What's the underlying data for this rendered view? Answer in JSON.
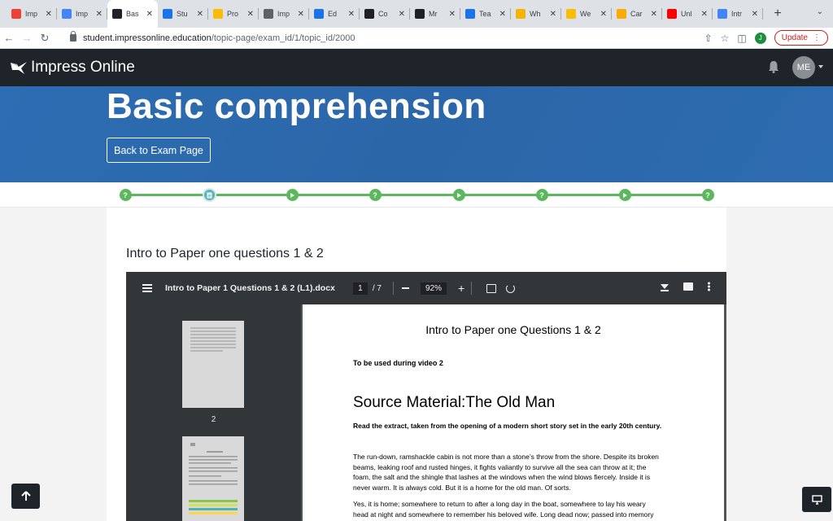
{
  "browser": {
    "tabs": [
      {
        "title": "Imp",
        "favicon": "gmail-icon",
        "color": "#ea4335"
      },
      {
        "title": "Imp",
        "favicon": "docs-icon",
        "color": "#4285f4"
      },
      {
        "title": "Bas",
        "favicon": "impress-book-icon",
        "color": "#202124",
        "active": true
      },
      {
        "title": "Stu",
        "favicon": "impress-bird-icon",
        "color": "#1a73e8"
      },
      {
        "title": "Pro",
        "favicon": "drive-icon",
        "color": "#fbbc04"
      },
      {
        "title": "Imp",
        "favicon": "globe-icon",
        "color": "#5f6368"
      },
      {
        "title": "Ed",
        "favicon": "star-icon",
        "color": "#1a73e8"
      },
      {
        "title": "Co",
        "favicon": "impress-book-icon",
        "color": "#202124"
      },
      {
        "title": "Mr",
        "favicon": "impress-book-icon",
        "color": "#202124"
      },
      {
        "title": "Tea",
        "favicon": "impress-bird-icon",
        "color": "#1a73e8"
      },
      {
        "title": "Wh",
        "favicon": "slides-icon",
        "color": "#f4b400"
      },
      {
        "title": "We",
        "favicon": "drive-icon",
        "color": "#fbbc04"
      },
      {
        "title": "Car",
        "favicon": "coin-icon",
        "color": "#f9ab00"
      },
      {
        "title": "Unl",
        "favicon": "youtube-icon",
        "color": "#ff0000"
      },
      {
        "title": "Intr",
        "favicon": "chrome-icon",
        "color": "#4285f4"
      }
    ],
    "url_host": "student.impressonline.education",
    "url_path": "/topic-page/exam_id/1/topic_id/2000",
    "profile_initial": "J",
    "update_label": "Update"
  },
  "site": {
    "brand": "Impress Online",
    "avatar_initials": "ME"
  },
  "hero": {
    "title": "Basic comprehension",
    "back_label": "Back to Exam Page"
  },
  "progress": {
    "nodes": [
      "question",
      "document",
      "play",
      "question",
      "play",
      "question",
      "play",
      "question"
    ],
    "accent": "#5cb85c"
  },
  "section": {
    "title": "Intro to Paper one questions 1 & 2"
  },
  "pdf_viewer": {
    "file_name": "Intro to Paper 1 Questions 1 & 2 (L1).docx",
    "current_page": "1",
    "total_pages": "/ 7",
    "zoom": "92%",
    "thumb_page_label": "2"
  },
  "document": {
    "heading": "Intro to Paper one Questions 1 & 2",
    "note": "To be used during video 2",
    "source_title": "Source Material:The Old Man",
    "intro_text": "Read the extract, taken from the opening of a modern short story set in the early 20th century.",
    "para1": [
      "The run-down, ramshackle cabin is not more than a stone’s throw from the shore. Despite its broken",
      "beams, leaking roof and rusted hinges, it fights valiantly to survive all the sea can throw at it; the",
      "foam, the salt and the shingle that lashes at the windows when the wind blows fiercely. Inside it is",
      "never warm. It is always cold. But it is a home for the old man. Of sorts."
    ],
    "para2": [
      "Yes, it is home; somewhere to return to after a long day in the boat, somewhere to lay his weary",
      "head at night and somewhere to remember his beloved wife.  Long dead now; passed into memory"
    ]
  }
}
